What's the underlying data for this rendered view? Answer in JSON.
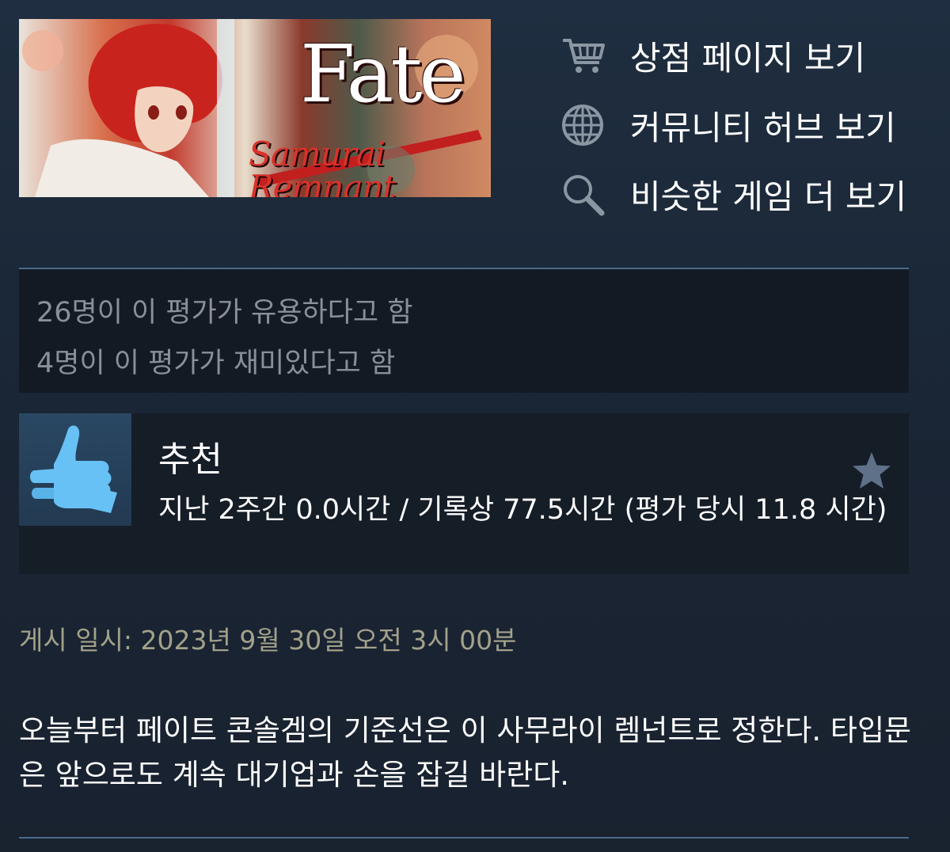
{
  "game": {
    "banner_title": "Fate",
    "banner_subtitle": "Samurai Remnant"
  },
  "links": [
    {
      "label": "상점 페이지 보기",
      "icon": "cart-icon"
    },
    {
      "label": "커뮤니티 허브 보기",
      "icon": "globe-icon"
    },
    {
      "label": "비슷한 게임 더 보기",
      "icon": "search-icon"
    }
  ],
  "votes": {
    "helpful": "26명이 이 평가가 유용하다고 함",
    "funny": "4명이 이 평가가 재미있다고 함"
  },
  "review": {
    "verdict": "추천",
    "verdict_icon": "thumbs-up-icon",
    "hours": "지난 2주간 0.0시간 / 기록상 77.5시간 (평가 당시 11.8 시간)",
    "award_icon": "star-icon",
    "posted": "게시 일시: 2023년 9월 30일 오전 3시 00분",
    "body": "오늘부터 페이트 콘솔겜의 기준선은 이 사무라이 렘넌트로 정한다. 타입문은 앞으로도 계속 대기업과 손을 잡길 바란다."
  },
  "colors": {
    "background": "#1b2838",
    "panel": "#131a23",
    "thumb_blue": "#66c0f4",
    "accent_line": "#4a6b8a",
    "date_text": "#a2a28a"
  }
}
